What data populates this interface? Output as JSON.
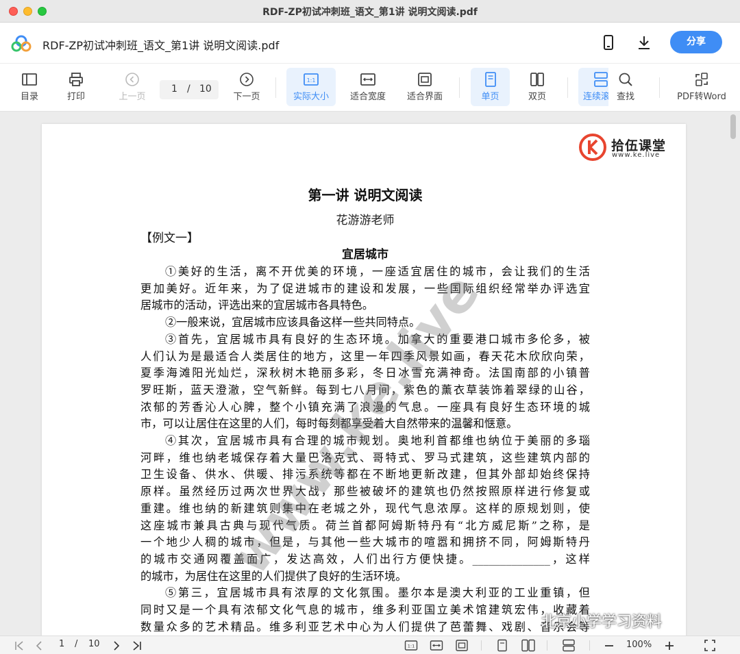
{
  "window": {
    "title": "RDF-ZP初试冲刺班_语文_第1讲 说明文阅读.pdf"
  },
  "header": {
    "document_name": "RDF-ZP初试冲刺班_语文_第1讲 说明文阅读.pdf",
    "share_label": "分享",
    "icons": [
      "cloud-logo-icon",
      "phone-icon",
      "download-icon"
    ]
  },
  "toolbar": {
    "toc": "目录",
    "print": "打印",
    "prev": "上一页",
    "page_current": "1",
    "page_sep": "/",
    "page_total": "10",
    "next": "下一页",
    "actual_size": "实际大小",
    "fit_width": "适合宽度",
    "fit_page": "适合界面",
    "single_page": "单页",
    "two_page": "双页",
    "continuous": "连续滚",
    "find": "查找",
    "pdf_to_word": "PDF转Word",
    "actual_size_icon_text": "1:1"
  },
  "document": {
    "brand_name": "拾伍课堂",
    "brand_url": "www.ke.live",
    "title": "第一讲  说明文阅读",
    "author": "花游游老师",
    "example": "【例文一】",
    "subtitle": "宜居城市",
    "lines": [
      "①美好的生活，离不开优美的环境，一座适宜居住的城市，会让我们的生活",
      "更加美好。近年来，为了促进城市的建设和发展，一些国际组织经常举办评选宜",
      "居城市的活动，评选出来的宜居城市各具特色。",
      "②一般来说，宜居城市应该具备这样一些共同特点。",
      "③首先，宜居城市具有良好的生态环境。加拿大的重要港口城市多伦多，被",
      "人们认为是最适合人类居住的地方，这里一年四季风景如画，春天花木欣欣向荣，",
      "夏季海滩阳光灿烂，深秋树木艳丽多彩，冬日冰雪充满神奇。法国南部的小镇普",
      "罗旺斯，蓝天澄澈，空气新鲜。每到七八月间，紫色的薰衣草装饰着翠绿的山谷，",
      "浓郁的芳香沁人心脾，整个小镇充满了浪漫的气息。一座具有良好生态环境的城",
      "市，可以让居住在这里的人们，每时每刻都享受着大自然带来的温馨和惬意。",
      "④其次，宜居城市具有合理的城市规划。奥地利首都维也纳位于美丽的多瑙",
      "河畔，维也纳老城保存着大量巴洛克式、哥特式、罗马式建筑，这些建筑内部的",
      "卫生设备、供水、供暖、排污系统等都在不断地更新改建，但其外部却始终保持",
      "原样。虽然经历过两次世界大战，那些被破坏的建筑也仍然按照原样进行修复或",
      "重建。维也纳的新建筑则集中在老城之外，现代气息浓厚。这样的原规划则，使",
      "这座城市兼具古典与现代气质。荷兰首都阿姆斯特丹有“北方威尼斯”之称，是",
      "一个地少人稠的城市，但是，与其他一些大城市的喧嚣和拥挤不同，阿姆斯特丹",
      "的城市交通网覆盖面广，发达高效，人们出行方便快捷。______________，这样",
      "的城市，为居住在这里的人们提供了良好的生活环境。",
      "⑤第三，宜居城市具有浓厚的文化氛围。墨尔本是澳大利亚的工业重镇，但",
      "同时又是一个具有浓郁文化气息的城市，维多利亚国立美术馆建筑宏伟，收藏着",
      "数量众多的艺术精品。维多利亚艺术中心为人们提供了芭蕾舞、戏剧、音乐会等"
    ],
    "watermark": "www.ke.live",
    "wechat_watermark": "北京小学学习资料"
  },
  "bottom": {
    "page_current": "1",
    "page_sep": "/",
    "page_total": "10",
    "zoom": "100%"
  },
  "colors": {
    "accent": "#3f8df5",
    "active_bg": "#e9f2fd"
  }
}
